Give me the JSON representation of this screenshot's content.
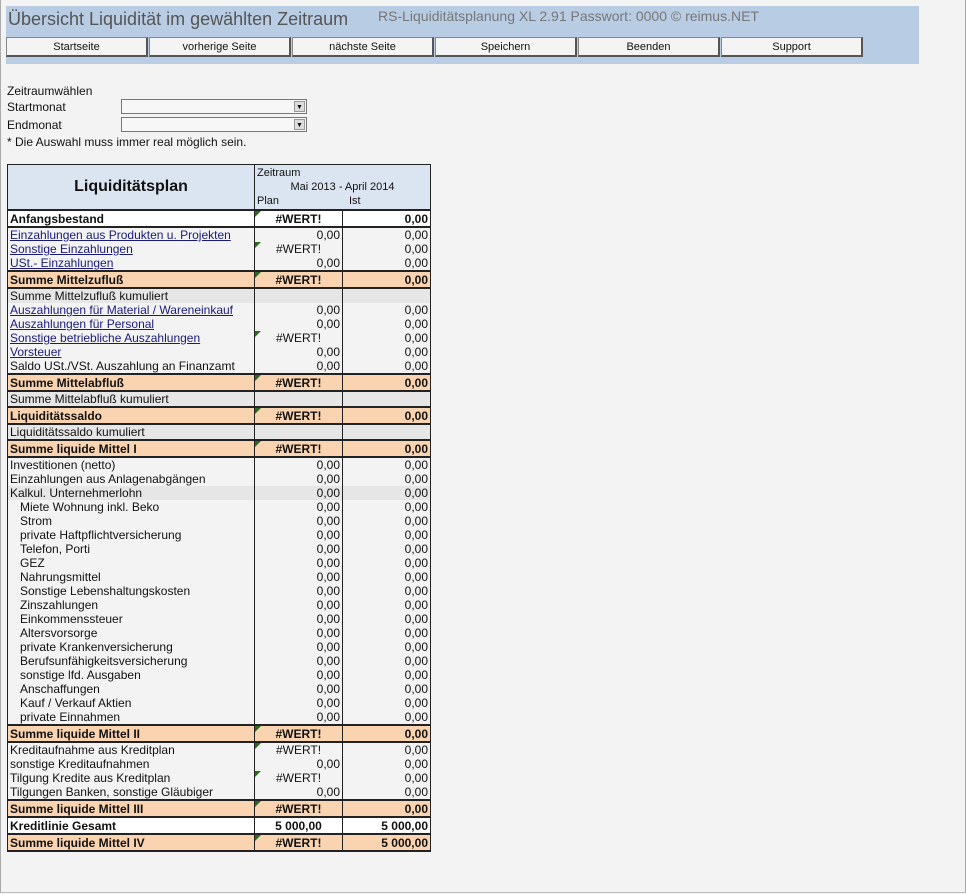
{
  "header": {
    "title": "Übersicht Liquidität im gewählten Zeitraum",
    "subtitle": "RS-Liquiditätsplanung XL 2.91 Passwort: 0000  © reimus.NET"
  },
  "buttons": [
    "Startseite",
    "vorherige Seite",
    "nächste Seite",
    "Speichern",
    "Beenden",
    "Support"
  ],
  "period": {
    "heading": "Zeitraumwählen",
    "start_label": "Startmonat",
    "start_value": "",
    "end_label": "Endmonat",
    "end_value": "",
    "note": "* Die Auswahl muss immer real möglich sein."
  },
  "table": {
    "title": "Liquiditätsplan",
    "period_label": "Zeitraum",
    "period": "Mai 2013 - April 2014",
    "col_plan": "Plan",
    "col_ist": "Ist",
    "rows": [
      {
        "t": "bw",
        "label": "Anfangsbestand",
        "plan": "#WERT!",
        "ist": "0,00",
        "tri": true
      },
      {
        "t": "l",
        "label": "Einzahlungen aus Produkten u. Projekten",
        "plan": "0,00",
        "ist": "0,00"
      },
      {
        "t": "l",
        "label": "Sonstige Einzahlungen",
        "plan": "#WERT!",
        "ist": "0,00",
        "tri": true
      },
      {
        "t": "l",
        "label": "USt.- Einzahlungen",
        "plan": "0,00",
        "ist": "0,00"
      },
      {
        "t": "b",
        "label": "Summe Mittelzufluß",
        "plan": "#WERT!",
        "ist": "0,00",
        "tri": true
      },
      {
        "t": "k",
        "label": "Summe Mittelzufluß kumuliert",
        "plan": "",
        "ist": ""
      },
      {
        "t": "l",
        "label": "Auszahlungen für Material / Wareneinkauf",
        "plan": "0,00",
        "ist": "0,00"
      },
      {
        "t": "l",
        "label": "Auszahlungen für Personal",
        "plan": "0,00",
        "ist": "0,00"
      },
      {
        "t": "l",
        "label": "Sonstige betriebliche Auszahlungen",
        "plan": "#WERT!",
        "ist": "0,00",
        "tri": true
      },
      {
        "t": "l",
        "label": "Vorsteuer",
        "plan": "0,00",
        "ist": "0,00"
      },
      {
        "t": "n",
        "label": "Saldo USt./VSt. Auszahlung an Finanzamt",
        "plan": "0,00",
        "ist": "0,00"
      },
      {
        "t": "b",
        "label": "Summe Mittelabfluß",
        "plan": "#WERT!",
        "ist": "0,00",
        "tri": true
      },
      {
        "t": "k",
        "label": "Summe Mittelabfluß kumuliert",
        "plan": "",
        "ist": ""
      },
      {
        "t": "b",
        "label": "Liquiditätssaldo",
        "plan": "#WERT!",
        "ist": "0,00",
        "tri": true
      },
      {
        "t": "k",
        "label": "Liquiditätssaldo  kumuliert",
        "plan": "",
        "ist": ""
      },
      {
        "t": "b",
        "label": "Summe liquide Mittel I",
        "plan": "#WERT!",
        "ist": "0,00",
        "tri": true
      },
      {
        "t": "n",
        "label": "Investitionen (netto)",
        "plan": "0,00",
        "ist": "0,00"
      },
      {
        "t": "n",
        "label": "Einzahlungen aus Anlagenabgängen",
        "plan": "0,00",
        "ist": "0,00"
      },
      {
        "t": "k",
        "label": "Kalkul. Unternehmerlohn",
        "plan": "0,00",
        "ist": "0,00"
      },
      {
        "t": "i",
        "label": "Miete Wohnung inkl. Beko",
        "plan": "0,00",
        "ist": "0,00"
      },
      {
        "t": "i",
        "label": "Strom",
        "plan": "0,00",
        "ist": "0,00"
      },
      {
        "t": "i",
        "label": "private Haftpflichtversicherung",
        "plan": "0,00",
        "ist": "0,00"
      },
      {
        "t": "i",
        "label": "Telefon, Porti",
        "plan": "0,00",
        "ist": "0,00"
      },
      {
        "t": "i",
        "label": "GEZ",
        "plan": "0,00",
        "ist": "0,00"
      },
      {
        "t": "i",
        "label": "Nahrungsmittel",
        "plan": "0,00",
        "ist": "0,00"
      },
      {
        "t": "i",
        "label": "Sonstige Lebenshaltungskosten",
        "plan": "0,00",
        "ist": "0,00"
      },
      {
        "t": "i",
        "label": "Zinszahlungen",
        "plan": "0,00",
        "ist": "0,00"
      },
      {
        "t": "i",
        "label": "Einkommenssteuer",
        "plan": "0,00",
        "ist": "0,00"
      },
      {
        "t": "i",
        "label": "Altersvorsorge",
        "plan": "0,00",
        "ist": "0,00"
      },
      {
        "t": "i",
        "label": "private Krankenversicherung",
        "plan": "0,00",
        "ist": "0,00"
      },
      {
        "t": "i",
        "label": "Berufsunfähigkeitsversicherung",
        "plan": "0,00",
        "ist": "0,00"
      },
      {
        "t": "i",
        "label": "sonstige lfd. Ausgaben",
        "plan": "0,00",
        "ist": "0,00"
      },
      {
        "t": "i",
        "label": "Anschaffungen",
        "plan": "0,00",
        "ist": "0,00"
      },
      {
        "t": "i",
        "label": "Kauf / Verkauf Aktien",
        "plan": "0,00",
        "ist": "0,00"
      },
      {
        "t": "i",
        "label": "private Einnahmen",
        "plan": "0,00",
        "ist": "0,00"
      },
      {
        "t": "b",
        "label": "Summe liquide Mittel II",
        "plan": "#WERT!",
        "ist": "0,00",
        "tri": true
      },
      {
        "t": "n",
        "label": "Kreditaufnahme aus Kreditplan",
        "plan": "#WERT!",
        "ist": "0,00",
        "tri": true
      },
      {
        "t": "n",
        "label": "sonstige Kreditaufnahmen",
        "plan": "0,00",
        "ist": "0,00"
      },
      {
        "t": "n",
        "label": "Tilgung Kredite aus Kreditplan",
        "plan": "#WERT!",
        "ist": "0,00",
        "tri": true
      },
      {
        "t": "n",
        "label": "Tilgungen Banken, sonstige Gläubiger",
        "plan": "0,00",
        "ist": "0,00"
      },
      {
        "t": "b",
        "label": "Summe liquide Mittel III",
        "plan": "#WERT!",
        "ist": "0,00",
        "tri": true
      },
      {
        "t": "bw",
        "label": "Kreditlinie Gesamt",
        "plan": "5 000,00",
        "ist": "5 000,00"
      },
      {
        "t": "b",
        "label": "Summe liquide Mittel IV",
        "plan": "#WERT!",
        "ist": "5 000,00",
        "tri": true
      }
    ]
  }
}
